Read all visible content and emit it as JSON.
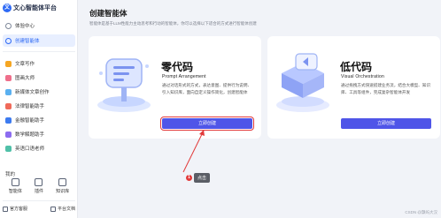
{
  "brand": {
    "logo_text": "文",
    "title": "文心智能体平台"
  },
  "sidebar": {
    "items": [
      {
        "label": "体验中心",
        "icon": "compass-icon",
        "color": "#7d8799",
        "active": false
      },
      {
        "label": "创建智能体",
        "icon": "plus-circle-icon",
        "color": "#2d69f5",
        "active": true
      },
      {
        "label": "文章写作",
        "icon": "writing-icon",
        "color": "#f5a623"
      },
      {
        "label": "图画大师",
        "icon": "painter-icon",
        "color": "#ef6f8b"
      },
      {
        "label": "新媒体文章创作",
        "icon": "media-icon",
        "color": "#5ab0f0"
      },
      {
        "label": "法律智能助手",
        "icon": "law-icon",
        "color": "#f06a5a"
      },
      {
        "label": "金融智能助手",
        "icon": "finance-icon",
        "color": "#3d7bf0"
      },
      {
        "label": "数学解题助手",
        "icon": "math-icon",
        "color": "#8c6cf0"
      },
      {
        "label": "英语口语老师",
        "icon": "english-icon",
        "color": "#50c0a8"
      }
    ],
    "mine_label": "我的",
    "mine_items": [
      {
        "label": "智能体",
        "icon": "agent-icon"
      },
      {
        "label": "插件",
        "icon": "plugin-icon"
      },
      {
        "label": "知识库",
        "icon": "knowledge-icon"
      }
    ],
    "footer": [
      {
        "label": "官方客服",
        "icon": "service-icon"
      },
      {
        "label": "平台文档",
        "icon": "docs-icon"
      }
    ]
  },
  "main": {
    "title": "创建智能体",
    "subtitle": "智能体是基于LLM性能力主动思考和行动的智能体，你可以选择以下适合的方式进行智能体创建",
    "cards": [
      {
        "title": "零代码",
        "en": "Prompt Arrangement",
        "desc": "通过对话形式的方式，表达意图、提供行为说明、引入知识库，面向自定义操作简化，创建智能体",
        "button": "立即创建"
      },
      {
        "title": "低代码",
        "en": "Visual Orchestration",
        "desc": "通过拖拽方式快速搭建业务流，结合大模型、知识库、工具等组件，完成复杂智能体开发",
        "button": "立即创建"
      }
    ],
    "tooltip": {
      "number": "1",
      "text": "点击"
    },
    "watermark": "CSDN @飘屿大汉"
  },
  "colors": {
    "accent": "#2d69f5",
    "button": "#4f55e8",
    "highlight": "#e23a3a"
  }
}
